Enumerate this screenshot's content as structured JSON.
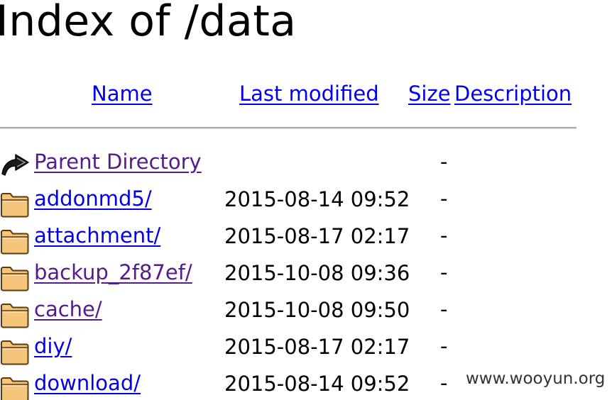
{
  "page": {
    "title": "Index of /data"
  },
  "columns": {
    "name": "Name",
    "last_modified": "Last modified",
    "size": "Size",
    "description": "Description"
  },
  "parent": {
    "icon": "back-arrow-icon",
    "label": "Parent Directory",
    "size": "-"
  },
  "rows": [
    {
      "name": "addonmd5/",
      "modified": "2015-08-14 09:52",
      "size": "-",
      "icon": "folder-icon",
      "visited": false
    },
    {
      "name": "attachment/",
      "modified": "2015-08-17 02:17",
      "size": "-",
      "icon": "folder-icon",
      "visited": false
    },
    {
      "name": "backup_2f87ef/",
      "modified": "2015-10-08 09:36",
      "size": "-",
      "icon": "folder-icon",
      "visited": true
    },
    {
      "name": "cache/",
      "modified": "2015-10-08 09:50",
      "size": "-",
      "icon": "folder-icon",
      "visited": true
    },
    {
      "name": "diy/",
      "modified": "2015-08-17 02:17",
      "size": "-",
      "icon": "folder-icon",
      "visited": false
    },
    {
      "name": "download/",
      "modified": "2015-08-14 09:52",
      "size": "-",
      "icon": "folder-icon",
      "visited": false
    }
  ],
  "watermark": "www.wooyun.org",
  "colors": {
    "link": "#0000ee",
    "visited_link": "#551a8b",
    "folder_fill": "#f5c57a",
    "folder_outline": "#5a3a12",
    "rule": "#a8a8a8"
  }
}
